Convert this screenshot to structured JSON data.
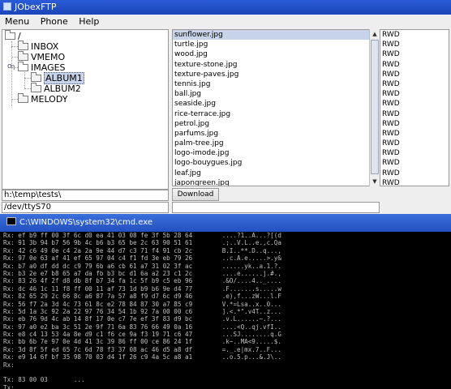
{
  "app": {
    "title": "JObexFTP",
    "menu": [
      "Menu",
      "Phone",
      "Help"
    ],
    "tree": {
      "root": "/",
      "items": [
        {
          "label": "INBOX"
        },
        {
          "label": "VMEMO"
        },
        {
          "label": "IMAGES"
        },
        {
          "label": "ALBUM1"
        },
        {
          "label": "ALBUM2"
        },
        {
          "label": "MELODY"
        }
      ]
    },
    "local_path": "h:\\temp\\tests\\",
    "device": "/dev/ttyS70",
    "download_label": "Download",
    "files": [
      "sunflower.jpg",
      "turtle.jpg",
      "wood.jpg",
      "texture-stone.jpg",
      "texture-paves.jpg",
      "tennis.jpg",
      "ball.jpg",
      "seaside.jpg",
      "rice-terrace.jpg",
      "petrol.jpg",
      "parfums.jpg",
      "palm-tree.jpg",
      "logo-imode.jpg",
      "logo-bouygues.jpg",
      "leaf.jpg",
      "japongreen.jpg"
    ],
    "permission": "RWD",
    "colors": {
      "selection": "#c6d3e8",
      "titlebar": "#2a5bd7"
    }
  },
  "cmd": {
    "title": "C:\\WINDOWS\\system32\\cmd.exe",
    "lines": [
      "Rx: ef b9 ff 00 3f 6c d0 ea 41 03 08 fe 3f 5b 28 64        ....?1..A...?[(d",
      "Rx: 91 3b 94 b7 56 9b 4c b6 b3 65 be 2c 63 90 51 61        .;..V.L..e.,c.Qa",
      "Rx: 42 c6 49 0e c4 2a 2a 9e 44 d7 c3 71 f4 91 cb 2c        B.I..**.D..q...,",
      "Rx: 97 0e 63 af 41 ef 65 97 04 c4 f1 fd 3e eb 79 26        ..c.A.e.....>.y&",
      "Rx: b7 a0 df dd dc c9 79 6b a6 cb 61 a7 31 02 3f ac        ......yk..a.1.?.",
      "Rx: b3 2e e7 b8 65 a7 da fb b3 bc d1 6a a2 23 c1 2c        ....e......j.#.,",
      "Rx: 83 26 4f 2f d8 db 8f b7 34 fa 1c 5f b9 c5 eb 96        .&O/....4.._....",
      "Rx: dc 46 1c 11 f8 ff 00 11 af 73 1d b9 b6 9e d4 77        .F.......s.....w",
      "Rx: 82 65 29 2c 66 8c a6 87 7a 57 a8 f9 d7 6c d9 46        .e),f...zW...l.F",
      "Rx: 56 f7 2a 3d 4c 73 61 8c e2 78 84 87 30 a7 85 c9        V.*=Lsa..x..0...",
      "Rx: 5d 1a 3c 92 2a 22 97 76 34 54 1b 92 7a 00 00 c6        ].<.*\".v4T..z...",
      "Rx: eb 76 9d 4c ab 14 8f 17 0e c7 7e ef 3f 83 d9 bc        .v.L......~.?...",
      "Rx: 97 a0 e2 ba 3c 51 2e 9f 71 6a 83 76 66 49 0a 16        ....<Q..qj.vfI..",
      "Rx: e8 c4 13 53 4a 8e d9 c1 f6 ce 9a f3 19 71 c6 47        ...SJ........q.G",
      "Rx: bb 6b 7e 97 0e 4d 41 3c 39 86 ff 00 ce 86 24 1f        .k~..MA<9.....$.",
      "Rx: 3d 8f 5f ed 65 7c 6d 78 f3 37 08 ac 46 d5 a8 df        =._.e|mx.7..F...",
      "Rx: e9 14 6f bf 35 98 70 03 d4 1f 26 c9 4a 5c a8 a1        ..o.5.p...&.J\\..",
      "Rx:",
      "",
      "Tx: 83 00 03       ...",
      "Tx:"
    ]
  }
}
